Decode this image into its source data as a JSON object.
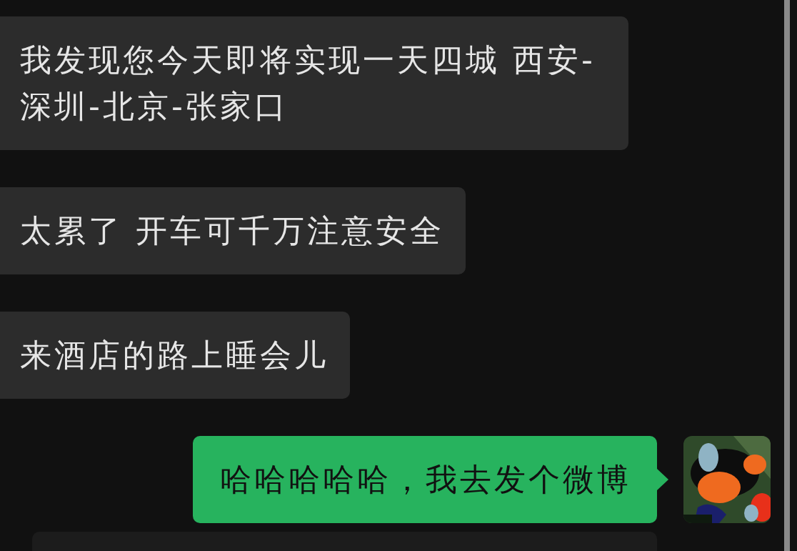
{
  "messages": [
    {
      "kind": "left",
      "text": "我发现您今天即将实现一天四城 西安-深圳-北京-张家口"
    },
    {
      "kind": "left",
      "text": "太累了 开车可千万注意安全"
    },
    {
      "kind": "left",
      "text": "来酒店的路上睡会儿"
    },
    {
      "kind": "right",
      "text": "哈哈哈哈哈，我去发个微博"
    },
    {
      "kind": "partial"
    }
  ]
}
